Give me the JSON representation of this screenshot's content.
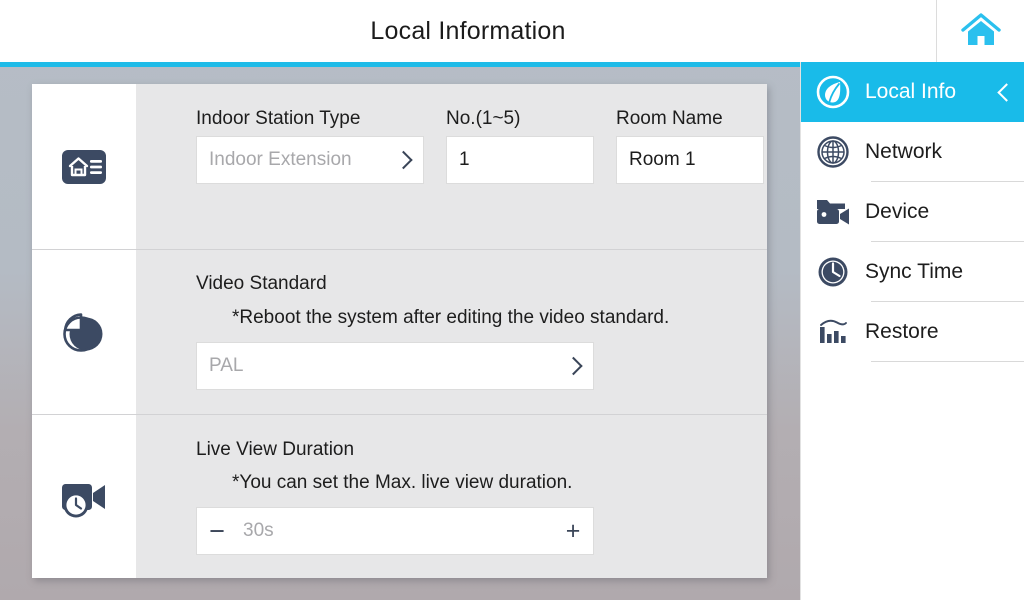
{
  "header": {
    "title": "Local Information",
    "home_icon": "home-icon"
  },
  "main": {
    "rows": [
      {
        "icon": "indoor-station-icon",
        "fields": [
          {
            "label": "Indoor Station Type",
            "value": "Indoor Extension",
            "muted": true,
            "control": "select"
          },
          {
            "label": "No.(1~5)",
            "value": "1",
            "muted": false,
            "control": "text"
          },
          {
            "label": "Room Name",
            "value": "Room 1",
            "muted": false,
            "control": "text"
          }
        ]
      },
      {
        "icon": "video-standard-icon",
        "label": "Video Standard",
        "note": "*Reboot the system after editing the video standard.",
        "value": "PAL",
        "control": "select"
      },
      {
        "icon": "live-view-duration-icon",
        "label": "Live View Duration",
        "note": "*You can set the Max. live view duration.",
        "value": "30s",
        "control": "stepper",
        "minus_label": "−",
        "plus_label": "+"
      }
    ]
  },
  "sidebar": {
    "items": [
      {
        "label": "Local Info",
        "icon": "leaf-icon",
        "active": true,
        "chevron": "chevron-left-icon"
      },
      {
        "label": "Network",
        "icon": "globe-icon",
        "active": false
      },
      {
        "label": "Device",
        "icon": "folder-camera-icon",
        "active": false
      },
      {
        "label": "Sync Time",
        "icon": "clock-icon",
        "active": false
      },
      {
        "label": "Restore",
        "icon": "bar-chart-icon",
        "active": false
      }
    ]
  },
  "colors": {
    "accent": "#19bbe9",
    "icon_navy": "#3c4a63",
    "panel_bg": "#e7e7e8",
    "desktop_bg": "#b4bbc4"
  }
}
